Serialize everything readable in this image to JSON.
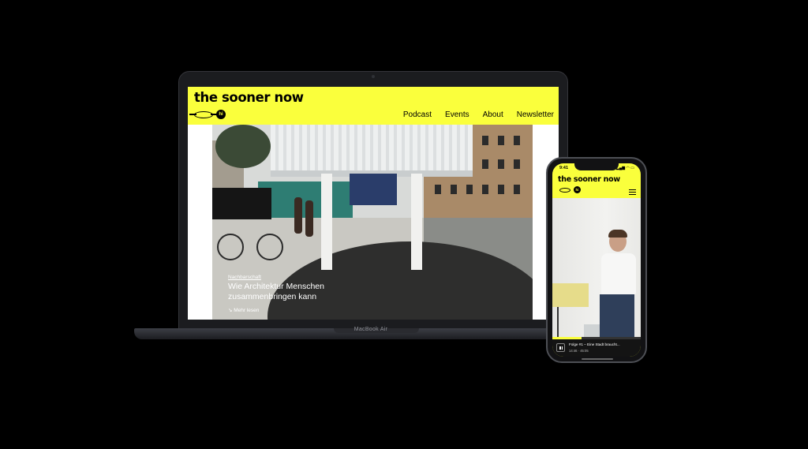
{
  "colors": {
    "brand_yellow": "#faff3c",
    "background": "#000000",
    "device_frame": "#1b1c1f"
  },
  "laptop": {
    "model_label": "MacBook Air",
    "site": {
      "title": "the sooner now",
      "logo_badge": "hi",
      "nav": [
        "Podcast",
        "Events",
        "About",
        "Newsletter"
      ],
      "hero": {
        "kicker": "Nachbarschaft",
        "headline": "Wie Architektur Menschen zusammenbringen kann",
        "more_link": "↘ Mehr lesen"
      }
    }
  },
  "phone": {
    "status_time": "9:41",
    "status_icons": "▂▄▆ ◠ ▭",
    "site_title": "the sooner now",
    "logo_badge": "hi",
    "menu_icon": "hamburger-icon",
    "player": {
      "episode_title": "Folge #1 – Eine Stadt braucht...",
      "elapsed": "14:46",
      "duration": "45:05",
      "time_display": "14:46 · 45:05",
      "progress": 0.33
    }
  }
}
